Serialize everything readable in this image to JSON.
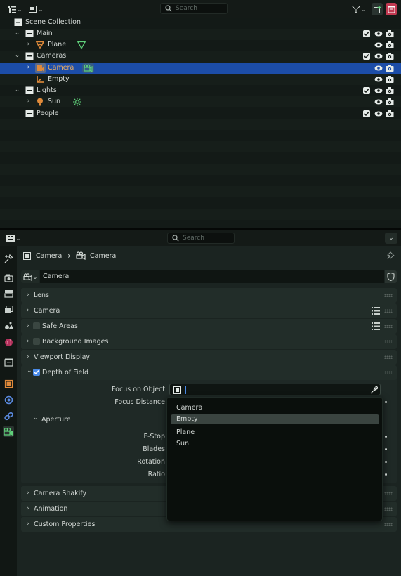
{
  "outliner": {
    "search_placeholder": "Search",
    "rows": [
      {
        "label": "Scene Collection",
        "icon": "scene-collection-icon"
      },
      {
        "label": "Main",
        "icon": "collection-icon"
      },
      {
        "label": "Plane",
        "icon": "mesh-object-icon"
      },
      {
        "label": "Cameras",
        "icon": "collection-icon"
      },
      {
        "label": "Camera",
        "icon": "camera-object-icon"
      },
      {
        "label": "Empty",
        "icon": "empty-object-icon"
      },
      {
        "label": "Lights",
        "icon": "collection-icon"
      },
      {
        "label": "Sun",
        "icon": "light-object-icon"
      },
      {
        "label": "People",
        "icon": "collection-icon"
      }
    ],
    "selected_row": "Camera",
    "colors": {
      "selection": "#1c4da8",
      "object_orange": "#e08a3a",
      "data_green": "#5fd07a",
      "collection_white": "#e6ebe8"
    }
  },
  "properties": {
    "search_placeholder": "Search",
    "breadcrumb": {
      "object": "Camera",
      "data": "Camera"
    },
    "datablock_name": "Camera",
    "panels": {
      "lens": "Lens",
      "camera": "Camera",
      "safe_areas": "Safe Areas",
      "background_images": "Background Images",
      "viewport_display": "Viewport Display",
      "depth_of_field": "Depth of Field",
      "aperture": "Aperture",
      "camera_shakify": "Camera Shakify",
      "animation": "Animation",
      "custom_properties": "Custom Properties"
    },
    "dof": {
      "use_dof": true,
      "focus_on_object_label": "Focus on Object",
      "focus_distance_label": "Focus Distance",
      "fstop_label": "F-Stop",
      "blades_label": "Blades",
      "rotation_label": "Rotation",
      "ratio_label": "Ratio"
    },
    "dropdown": {
      "items": [
        "Camera",
        "Empty",
        "Plane",
        "Sun"
      ],
      "highlighted": "Empty"
    }
  }
}
